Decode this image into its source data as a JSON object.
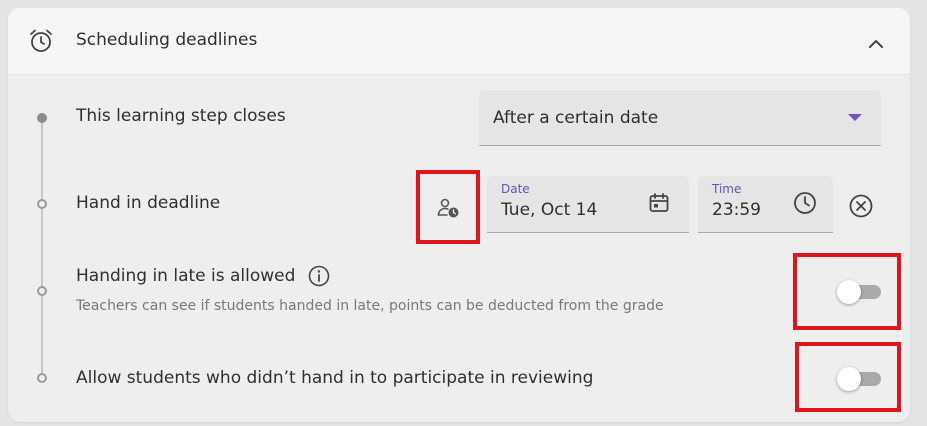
{
  "section": {
    "title": "Scheduling deadlines",
    "icon": "alarm-clock-icon",
    "collapse_icon": "chevron-up-icon"
  },
  "rows": {
    "closes": {
      "label": "This learning step closes",
      "select_value": "After a certain date"
    },
    "deadline": {
      "label": "Hand in deadline",
      "date_label": "Date",
      "date_value": "Tue, Oct 14",
      "time_label": "Time",
      "time_value": "23:59"
    },
    "late": {
      "label": "Handing in late is allowed",
      "hint": "Teachers can see if students handed in late, points can be deducted from the grade",
      "enabled": false
    },
    "reviewing": {
      "label": "Allow students who didn’t hand in to participate in reviewing",
      "enabled": false
    }
  },
  "colors": {
    "accent": "#7a4fc4",
    "highlight": "#e0141b"
  }
}
